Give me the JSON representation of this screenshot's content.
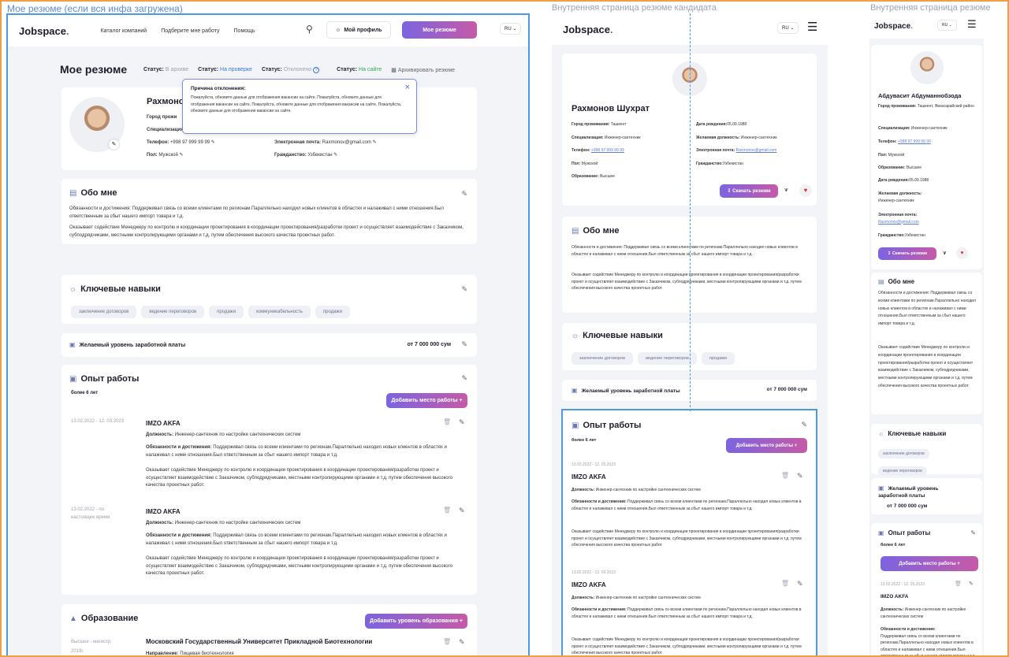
{
  "labels": {
    "a1": "Мое резюме (если вся инфа загружена)",
    "a2": "Внутренняя страница резюме кандидата",
    "a3": "Внутренняя страница резюме"
  },
  "header": {
    "logo": "Jobspace",
    "nav": [
      "Каталог компаний",
      "Подберите мне работу",
      "Помощь"
    ],
    "profile": "Мой профиль",
    "resume": "Мое резюме",
    "lang": "RU"
  },
  "status": {
    "title": "Мое резюме",
    "label": "Статус:",
    "archive": "В архиве",
    "review": "На проверке",
    "rejected": "Отклонено",
    "onsite": "На сайте",
    "archive_btn": "Архивировать резюме"
  },
  "popup": {
    "title": "Причина отклонения:",
    "text": "Пожалуйста, обновите данные для отображения вакансии на сайте. Пожалуйста, обновите данные для отображения вакансии на сайте. Пожалуйста, обновите данные для отображения вакансии на сайте. Пожалуйста, обновите данные для отображения вакансии на сайте."
  },
  "profile": {
    "name": "Рахмонов Шухрат",
    "city_l": "Город проживания:",
    "city": "Ташкент",
    "spec_l": "Специализация:",
    "spec": "Инженер-сантехник",
    "phone_l": "Телефон:",
    "phone": "+998 97 999 99 99",
    "sex_l": "Пол:",
    "sex": "Мужской",
    "email_l": "Электронная почта:",
    "email": "Raxmonov@gmail.com",
    "citizen_l": "Гражданство:",
    "citizen": "Узбекистан",
    "edu_l": "Образование:",
    "edu": "Высшее",
    "bd_l": "Дата рождения:",
    "bd": "05.09.1988",
    "pos_l": "Желаемая должность:",
    "pos": "Инженер-сантехник",
    "download": "Скачать резюме"
  },
  "profile3": {
    "name": "Абдувасит Абдуманнобзода",
    "city": "Ташкент, Яккасарайский район",
    "pos_l": "Желаемая должность:",
    "email": "Raxmonov@gmail.com"
  },
  "paren": "Город прожи",
  "about": {
    "title": "Обо мне",
    "p1": "Обязанности и достижения: Поддерживал связь со всеми клиентами по регионам.Параллельно находил новых клиентов в областях и налаживал с ними отношения.Был ответственным за сбыт нашего импорт товара и т.д.",
    "p2": "Оказывает содействие Менеджеру по контролю и координации проектирования в координации проектирования/разработки проект и осуществляет взаимодействие с Заказчиком, субподрядчиками, местными контролирующими органами и т.д. путем обеспечения высокого качества проектных работ."
  },
  "skills": {
    "title": "Ключевые навыки",
    "tags": [
      "заключение договоров",
      "ведение переговоров",
      "продажи",
      "коммуникабельность",
      "продажи"
    ]
  },
  "salary": {
    "title": "Желаемый уровень заработной платы",
    "value": "от 7 000 000 сум"
  },
  "work": {
    "title": "Опыт работы",
    "total": "более 6 лет",
    "add": "Добавить место работы",
    "jobs": [
      {
        "dates": "13.02.2022 - 12. 03.2023",
        "company": "IMZO AKFA",
        "pos_l": "Должность:",
        "pos": "Инженер-сантехник по настройке сантехнических систем",
        "duty_l": "Обязанности и достижения:",
        "duty": "Поддерживал связь со всеми клиентами по регионам.Параллельно находил новых клиентов в областях и налаживал с ними отношения.Был ответственным за сбыт нашего импорт товара и т.д.",
        "extra": "Оказывает содействие Менеджеру по контролю и координации проектирования в координации проектирования/разработки проект и осуществляет взаимодействие с Заказчиком, субподрядчиками, местными контролирующими органами и т.д. путем обеспечения высокого качества проектных работ."
      },
      {
        "dates": "13.02.2022 - по настоящее время",
        "company": "IMZO AKFA",
        "pos_l": "Должность:",
        "pos": "Инженер-сантехник по настройке сантехнических систем",
        "duty_l": "Обязанности и достижения:",
        "duty": "Поддерживал связь со всеми клиентами по регионам.Параллельно находил новых клиентов в областях и налаживал с ними отношения.Был ответственным за сбыт нашего импорт товара и т.д.",
        "extra": "Оказывает содействие Менеджеру по контролю и координации проектирования в координации проектирования/разработки проект и осуществляет взаимодействие с Заказчиком, субподрядчиками, местными контролирующими органами и т.д. путем обеспечения высокого качества проектных работ."
      }
    ]
  },
  "education": {
    "title": "Образование",
    "add": "Добавить уровень образования",
    "degree": "Высшее - магистр",
    "year": "2019г.",
    "uni": "Московский Государственный Университет Прикладной Биотехнологии",
    "dir_l": "Направление:",
    "dir": "Пищевая биотехнология"
  }
}
